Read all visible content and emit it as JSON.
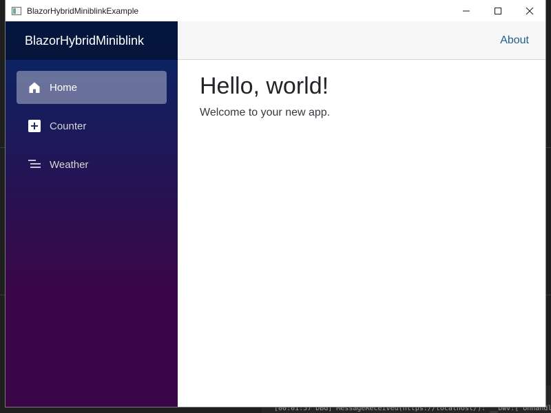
{
  "window": {
    "title": "BlazorHybridMiniblinkExample",
    "controls": [
      "minimize-icon",
      "maximize-icon",
      "close-icon"
    ]
  },
  "sidebar": {
    "brand": "BlazorHybridMiniblink",
    "items": [
      {
        "label": "Home",
        "icon": "home-icon",
        "active": true
      },
      {
        "label": "Counter",
        "icon": "plus-icon",
        "active": false
      },
      {
        "label": "Weather",
        "icon": "list-icon",
        "active": false
      }
    ]
  },
  "top_row": {
    "about_label": "About"
  },
  "main": {
    "heading": "Hello, world!",
    "subtitle": "Welcome to your new app."
  },
  "background_editor": {
    "bottom_log": "[00:01:57 DBG] MessageReceived(https://localhost/): __bwv:[\"Unhandl"
  },
  "colors": {
    "sidebar_top": "#052767",
    "sidebar_bottom": "#3a0647",
    "link": "#1f5e8c"
  }
}
